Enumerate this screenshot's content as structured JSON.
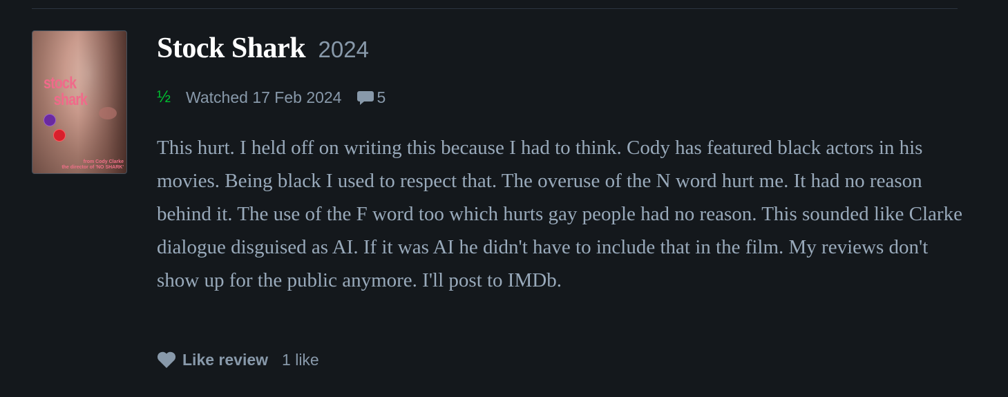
{
  "film": {
    "title": "Stock Shark",
    "year": "2024",
    "poster": {
      "title_line1": "stock",
      "title_line2": "shark",
      "credit_line1": "from Cody Clarke",
      "credit_line2": "the director of 'NO SHARK'"
    }
  },
  "meta": {
    "rating": "½",
    "watched": "Watched 17 Feb 2024",
    "comment_icon": "speech-bubble-icon",
    "comment_count": "5"
  },
  "review": {
    "text": "This hurt. I held off on writing this because I had to think. Cody has featured black actors in his movies. Being black I used to respect that. The overuse of the N word hurt me. It had no reason behind it. The use of the F word too which hurts gay people had no reason. This sounded like Clarke dialogue disguised as AI. If it was AI he didn't have to include that in the film. My reviews don't show up for the public anymore. I'll post to IMDb."
  },
  "actions": {
    "like_icon": "heart-icon",
    "like_label": "Like review",
    "like_count": "1 like"
  },
  "colors": {
    "background": "#14181c",
    "rating": "#00c030",
    "muted": "#8899aa",
    "text": "#99aabb"
  }
}
